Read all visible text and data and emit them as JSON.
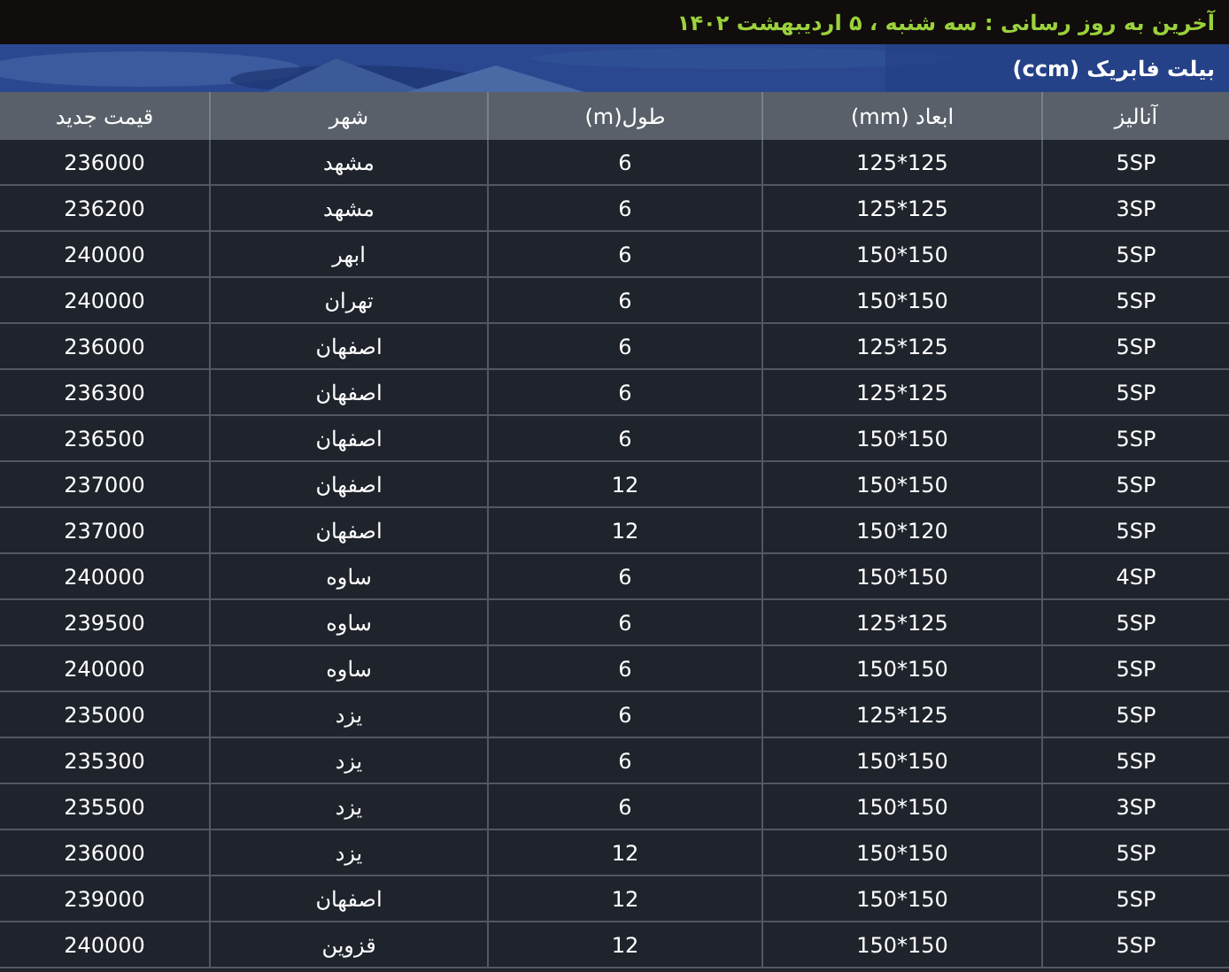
{
  "last_update": "آخرین به روز رسانی : سه شنبه ، ۵ اردیبهشت ۱۴۰۲",
  "banner": {
    "title": "بیلت فابریک (ccm)"
  },
  "table": {
    "columns": [
      "آنالیز",
      "ابعاد (mm)",
      "طول(m)",
      "شهر",
      "قیمت جدید"
    ],
    "rows": [
      [
        "5SP",
        "125*125",
        "6",
        "مشهد",
        "236000"
      ],
      [
        "3SP",
        "125*125",
        "6",
        "مشهد",
        "236200"
      ],
      [
        "5SP",
        "150*150",
        "6",
        "ابهر",
        "240000"
      ],
      [
        "5SP",
        "150*150",
        "6",
        "تهران",
        "240000"
      ],
      [
        "5SP",
        "125*125",
        "6",
        "اصفهان",
        "236000"
      ],
      [
        "5SP",
        "125*125",
        "6",
        "اصفهان",
        "236300"
      ],
      [
        "5SP",
        "150*150",
        "6",
        "اصفهان",
        "236500"
      ],
      [
        "5SP",
        "150*150",
        "12",
        "اصفهان",
        "237000"
      ],
      [
        "5SP",
        "150*120",
        "12",
        "اصفهان",
        "237000"
      ],
      [
        "4SP",
        "150*150",
        "6",
        "ساوه",
        "240000"
      ],
      [
        "5SP",
        "125*125",
        "6",
        "ساوه",
        "239500"
      ],
      [
        "5SP",
        "150*150",
        "6",
        "ساوه",
        "240000"
      ],
      [
        "5SP",
        "125*125",
        "6",
        "یزد",
        "235000"
      ],
      [
        "5SP",
        "150*150",
        "6",
        "یزد",
        "235300"
      ],
      [
        "3SP",
        "150*150",
        "6",
        "یزد",
        "235500"
      ],
      [
        "5SP",
        "150*150",
        "12",
        "یزد",
        "236000"
      ],
      [
        "5SP",
        "150*150",
        "12",
        "اصفهان",
        "239000"
      ],
      [
        "5SP",
        "150*150",
        "12",
        "قزوین",
        "240000"
      ]
    ]
  }
}
